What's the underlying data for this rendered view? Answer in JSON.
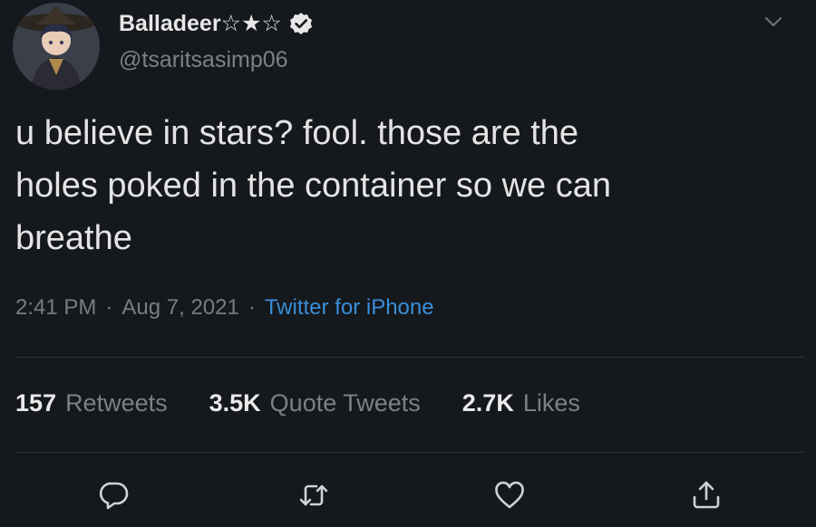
{
  "author": {
    "display_name": "Balladeer☆★☆",
    "username": "@tsaritsasimp06",
    "verified": true,
    "avatar": "character-portrait-avatar"
  },
  "tweet": {
    "text_lines": [
      "u believe in stars? fool. those are the",
      "holes poked in the container so we can",
      "breathe"
    ],
    "time": "2:41 PM",
    "date": "Aug 7, 2021",
    "separator": "·",
    "source": "Twitter for iPhone"
  },
  "stats": {
    "retweets_count": "157",
    "retweets_label": "Retweets",
    "quotes_count": "3.5K",
    "quotes_label": "Quote Tweets",
    "likes_count": "2.7K",
    "likes_label": "Likes"
  },
  "actions": {
    "reply_icon": "reply-icon",
    "retweet_icon": "retweet-icon",
    "like_icon": "like-icon",
    "share_icon": "share-icon"
  },
  "colors": {
    "background": "#15181c",
    "link": "#3a8ed8",
    "muted": "#767d83",
    "text": "#e4e4e4"
  }
}
